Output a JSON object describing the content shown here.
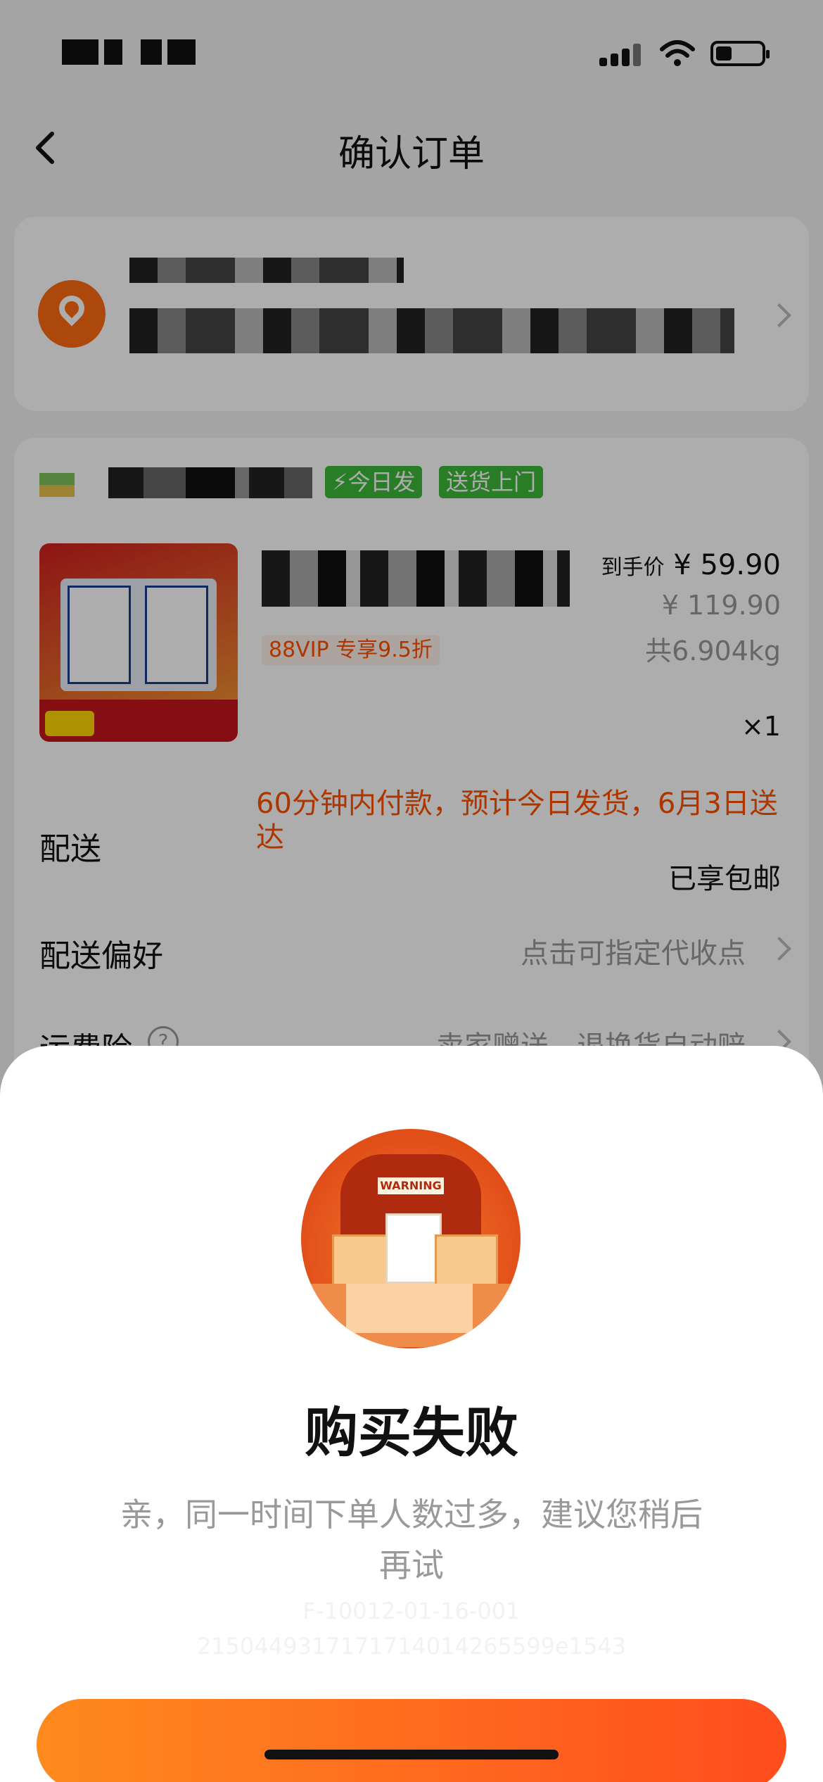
{
  "nav": {
    "title": "确认订单"
  },
  "shop": {
    "tags": [
      "今日发",
      "送货上门"
    ]
  },
  "product": {
    "vip_tag": "88VIP 专享9.5折",
    "final_price_label": "到手价",
    "final_price": "¥ 59.90",
    "original_price": "¥ 119.90",
    "weight": "共6.904kg",
    "quantity": "×1"
  },
  "delivery": {
    "label": "配送",
    "info": "60分钟内付款，预计今日发货，6月3日送达",
    "shipping": "已享包邮"
  },
  "preference": {
    "label": "配送偏好",
    "value": "点击可指定代收点"
  },
  "insurance": {
    "label": "运费险",
    "help": "?",
    "value": "卖家赠送，退换货自动赔"
  },
  "dialog": {
    "illustration_text": "WARNING",
    "title": "购买失败",
    "message": "亲，同一时间下单人数过多，建议您稍后再试",
    "code_line1": "F-10012-01-16-001",
    "code_line2": "2150449317171714014265599e1543"
  },
  "colors": {
    "accent": "#ff5000",
    "green_tag": "#3fb83a",
    "button_start": "#ff8a1e",
    "button_end": "#ff4d1e"
  }
}
